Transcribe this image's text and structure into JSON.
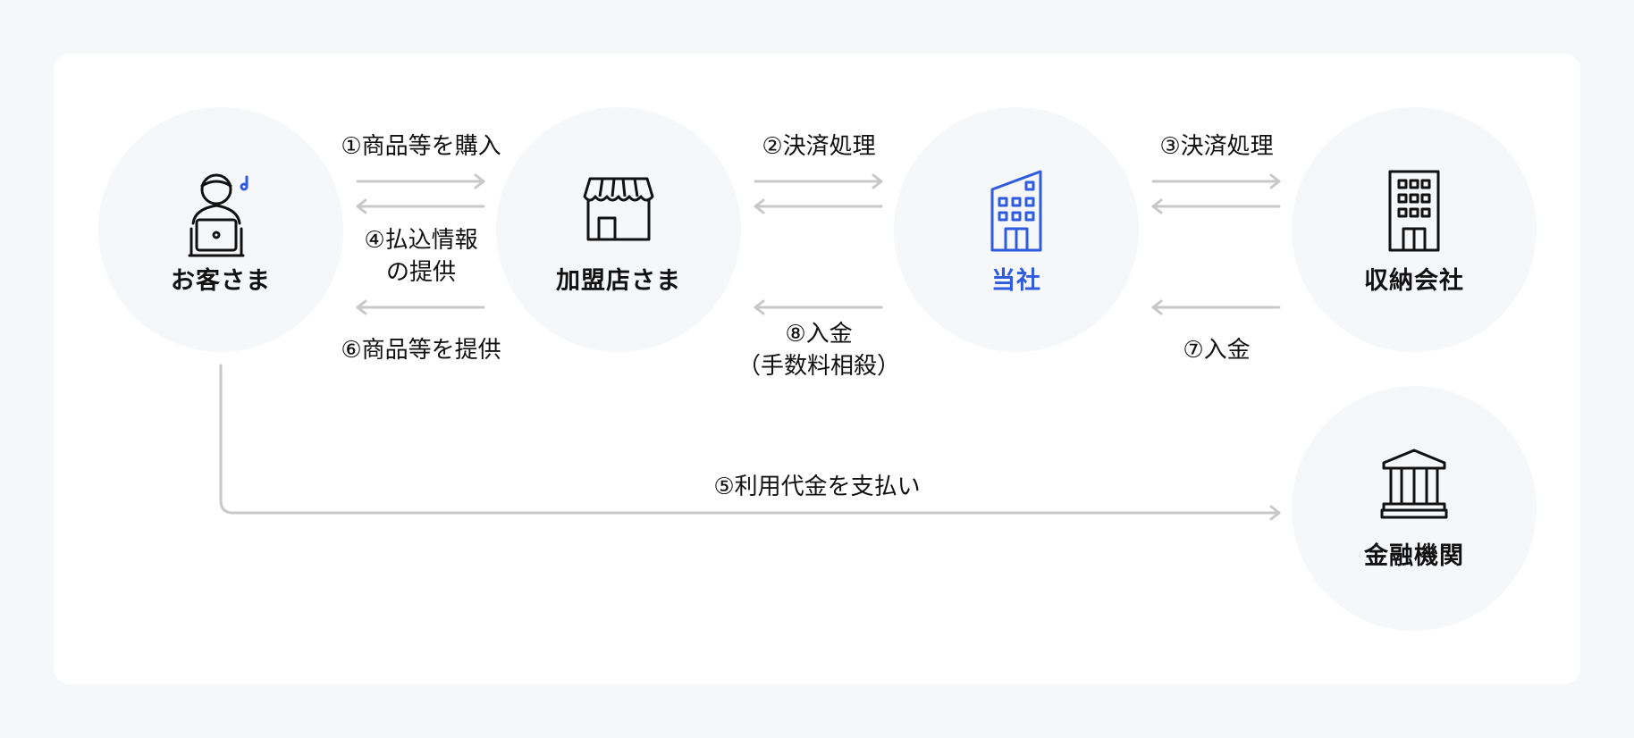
{
  "nodes": {
    "customer": {
      "label": "お客さま",
      "icon": "customer-with-laptop-icon"
    },
    "merchant": {
      "label": "加盟店さま",
      "icon": "storefront-icon"
    },
    "company": {
      "label": "当社",
      "icon": "office-building-icon",
      "color": "#2f5be0"
    },
    "collector": {
      "label": "収納会社",
      "icon": "office-building-icon"
    },
    "bank": {
      "label": "金融機関",
      "icon": "bank-icon"
    }
  },
  "steps": {
    "s1": "①商品等を購入",
    "s2": "②決済処理",
    "s3": "③決済処理",
    "s4_line1": "④払込情報",
    "s4_line2": "の提供",
    "s5": "⑤利用代金を支払い",
    "s6": "⑥商品等を提供",
    "s7": "⑦入金",
    "s8_line1": "⑧入金",
    "s8_line2": "（手数料相殺）"
  },
  "colors": {
    "accent": "#2f5be0",
    "arrow": "#c8c8c8",
    "circle": "#f6f7f9"
  }
}
